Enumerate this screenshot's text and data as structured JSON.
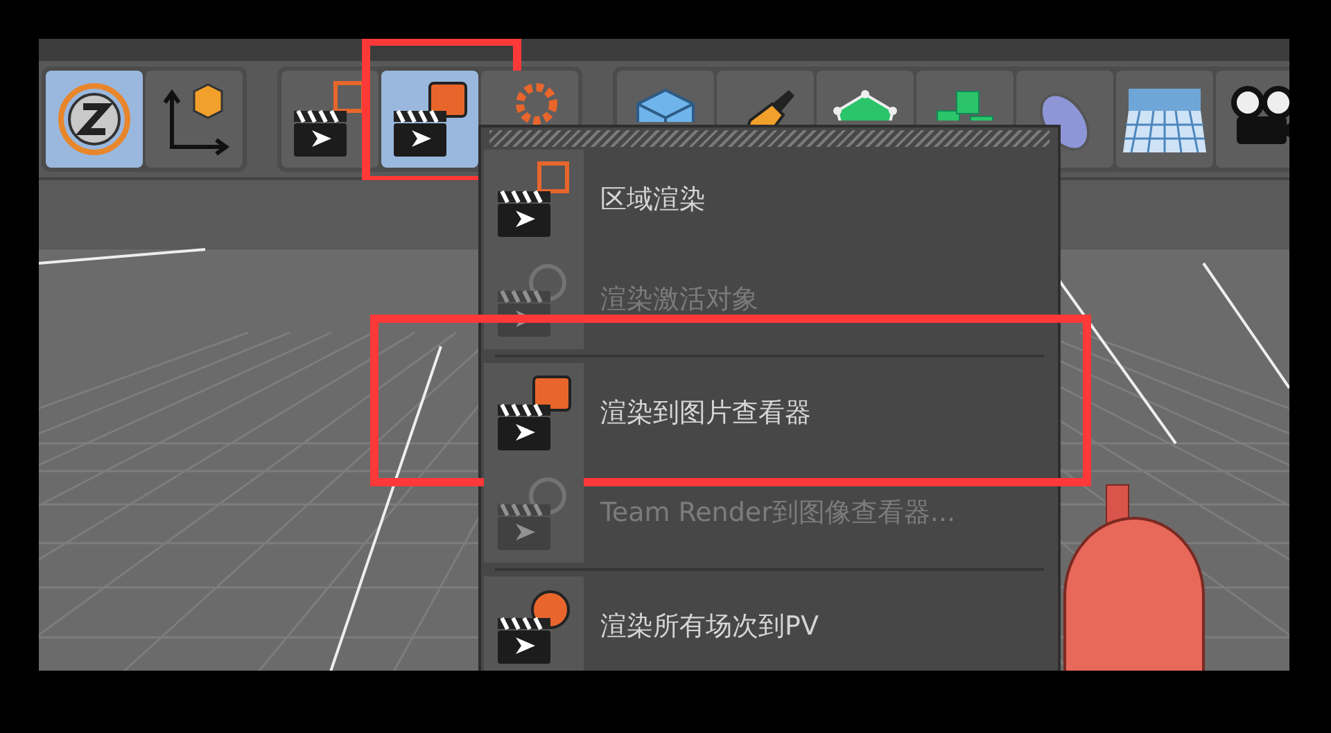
{
  "toolbar": {
    "groups": [
      {
        "buttons": [
          {
            "selected": true
          },
          {
            "selected": false
          }
        ]
      },
      {
        "buttons": [
          {
            "selected": false
          },
          {
            "selected": true,
            "annotated": true
          },
          {
            "selected": false
          }
        ]
      },
      {
        "buttons": [
          {
            "selected": false
          },
          {
            "selected": false
          },
          {
            "selected": false
          },
          {
            "selected": false
          },
          {
            "selected": false
          },
          {
            "selected": false
          },
          {
            "selected": false
          }
        ]
      }
    ]
  },
  "menu": {
    "items": [
      {
        "kind": "item",
        "label": "区域渲染",
        "disabled": false
      },
      {
        "kind": "item",
        "label": "渲染激活对象",
        "disabled": true
      },
      {
        "kind": "separator"
      },
      {
        "kind": "item",
        "label": "渲染到图片查看器",
        "disabled": false,
        "annotated": true
      },
      {
        "kind": "item",
        "label": "Team Render到图像查看器...",
        "disabled": true
      },
      {
        "kind": "separator"
      },
      {
        "kind": "item",
        "label": "渲染所有场次到PV",
        "disabled": false
      }
    ]
  }
}
